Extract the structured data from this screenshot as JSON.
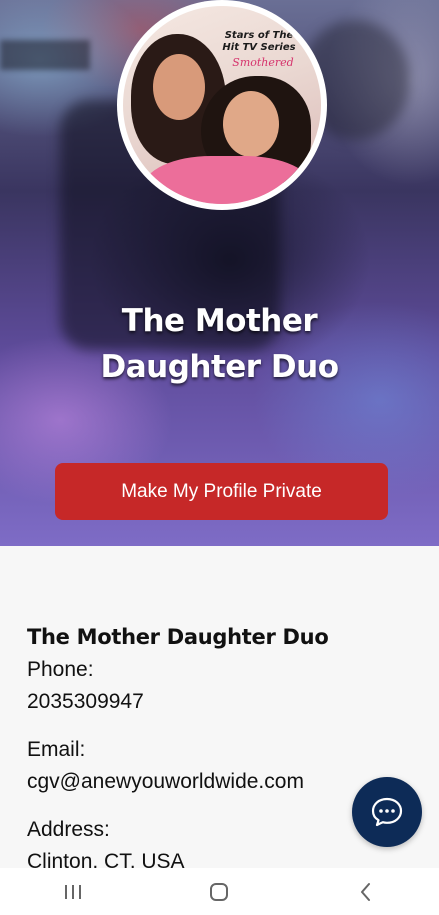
{
  "avatar": {
    "caption_line1": "Stars of The",
    "caption_line2": "Hit TV Series",
    "caption_show": "Smothered"
  },
  "hero": {
    "title_line1": "The Mother",
    "title_line2": "Daughter Duo"
  },
  "actions": {
    "private_button_label": "Make My Profile Private"
  },
  "profile": {
    "name": "The Mother Daughter Duo",
    "phone_label": "Phone:",
    "phone_value": "2035309947",
    "email_label": "Email:",
    "email_value": "cgv@anewyouworldwide.com",
    "address_label": "Address:",
    "address_value": "Clinton, CT, USA"
  },
  "chat": {
    "icon": "chat-bubble-icon",
    "color": "#0d2b57"
  },
  "nav": {
    "recents_icon": "recent-apps-icon",
    "home_icon": "home-icon",
    "back_icon": "back-icon"
  },
  "colors": {
    "button": "#c62828",
    "page_background": "#f7f7f7"
  }
}
